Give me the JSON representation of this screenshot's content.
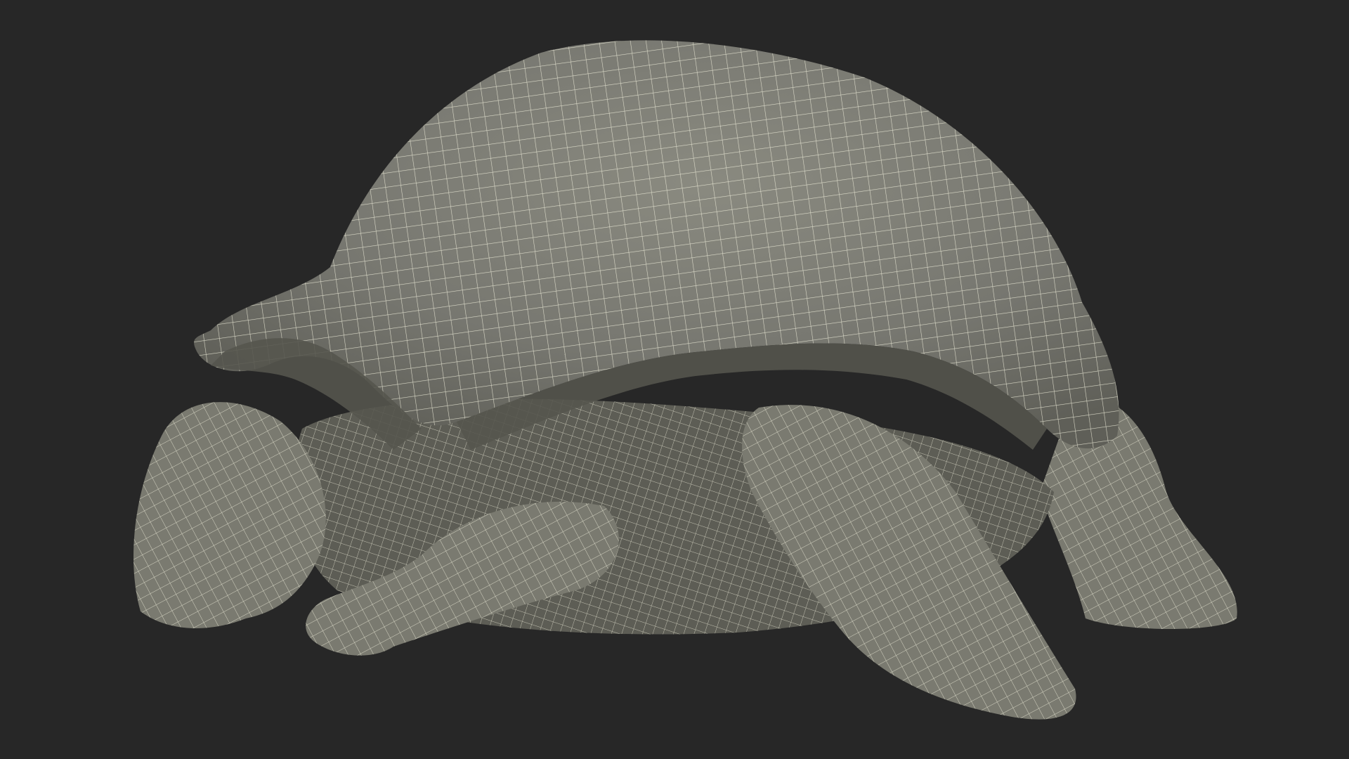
{
  "scene": {
    "subject": "tortoise-wireframe-model",
    "colors": {
      "background": "#272727",
      "surface": "#7a7a70",
      "surface_dark": "#5d5d55",
      "surface_light": "#8b8b82",
      "wire": "#ecebd8"
    }
  }
}
